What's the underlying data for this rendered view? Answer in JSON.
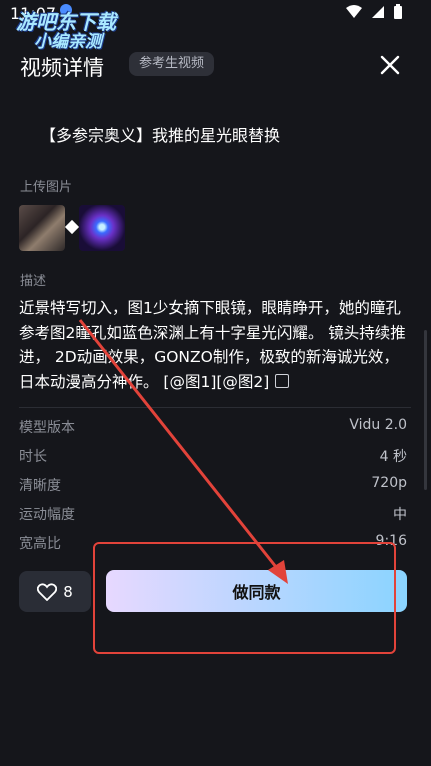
{
  "status_bar": {
    "time": "11:07"
  },
  "watermark": {
    "line1": "游吧东下载",
    "line2": "小编亲测"
  },
  "header": {
    "title": "视频详情",
    "tag": "参考生视频"
  },
  "prompt_title": "【多参宗奥义】我推的星光眼替换",
  "upload": {
    "label": "上传图片"
  },
  "description": {
    "label": "描述",
    "text": "近景特写切入，图1少女摘下眼镜，眼睛睁开，她的瞳孔参考图2瞳孔如蓝色深渊上有十字星光闪耀。 镜头持续推进， 2D动画效果，GONZO制作，极致的新海诚光效，日本动漫高分神作。 [@图1][@图2]"
  },
  "specs": [
    {
      "key": "模型版本",
      "value": "Vidu 2.0"
    },
    {
      "key": "时长",
      "value": "4 秒"
    },
    {
      "key": "清晰度",
      "value": "720p"
    },
    {
      "key": "运动幅度",
      "value": "中"
    },
    {
      "key": "宽高比",
      "value": "9:16"
    }
  ],
  "actions": {
    "like_count": "8",
    "make_same": "做同款"
  },
  "icons": [
    "wifi-icon",
    "signal-icon",
    "battery-icon",
    "close-icon",
    "heart-icon",
    "copy-icon",
    "link-icon"
  ],
  "colors": {
    "background": "#15161b",
    "accent_start": "#e7d8ff",
    "accent_end": "#8ad4ff",
    "annotation": "#e2433a"
  }
}
